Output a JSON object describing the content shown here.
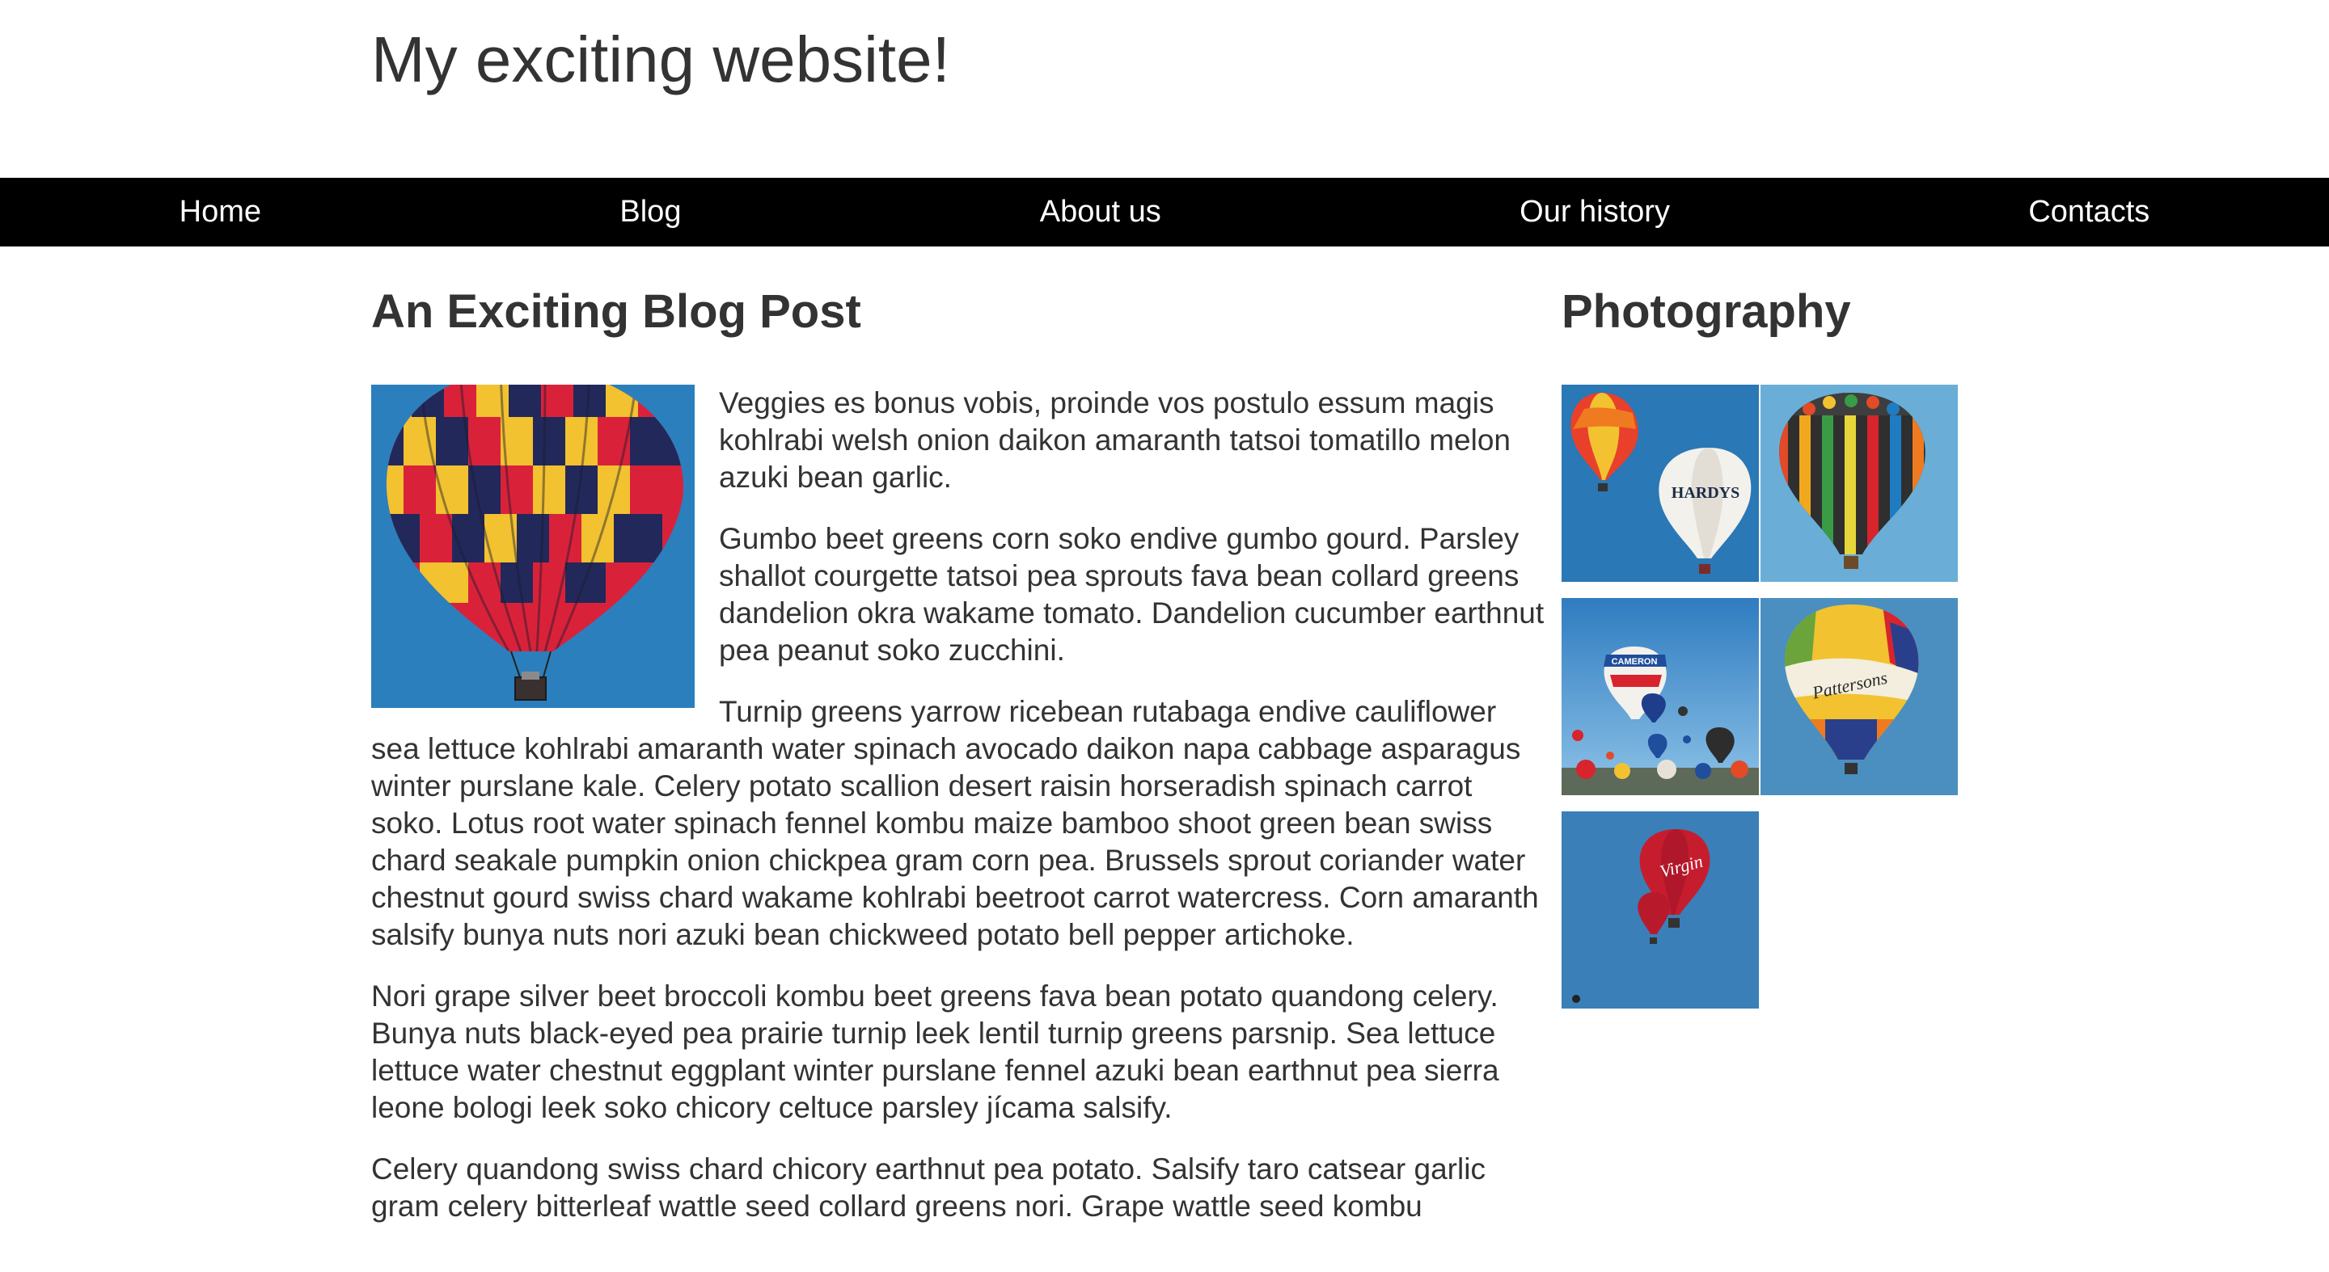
{
  "site": {
    "title": "My exciting website!"
  },
  "nav": {
    "items": [
      {
        "label": "Home"
      },
      {
        "label": "Blog"
      },
      {
        "label": "About us"
      },
      {
        "label": "Our history"
      },
      {
        "label": "Contacts"
      }
    ]
  },
  "post": {
    "title": "An Exciting Blog Post",
    "paragraphs": [
      "Veggies es bonus vobis, proinde vos postulo essum magis kohlrabi welsh onion daikon amaranth tatsoi tomatillo melon azuki bean garlic.",
      "Gumbo beet greens corn soko endive gumbo gourd. Parsley shallot courgette tatsoi pea sprouts fava bean collard greens dandelion okra wakame tomato. Dandelion cucumber earthnut pea peanut soko zucchini.",
      "Turnip greens yarrow ricebean rutabaga endive cauliflower sea lettuce kohlrabi amaranth water spinach avocado daikon napa cabbage asparagus winter purslane kale. Celery potato scallion desert raisin horseradish spinach carrot soko. Lotus root water spinach fennel kombu maize bamboo shoot green bean swiss chard seakale pumpkin onion chickpea gram corn pea. Brussels sprout coriander water chestnut gourd swiss chard wakame kohlrabi beetroot carrot watercress. Corn amaranth salsify bunya nuts nori azuki bean chickweed potato bell pepper artichoke.",
      "Nori grape silver beet broccoli kombu beet greens fava bean potato quandong celery. Bunya nuts black-eyed pea prairie turnip leek lentil turnip greens parsnip. Sea lettuce lettuce water chestnut eggplant winter purslane fennel azuki bean earthnut pea sierra leone bologi leek soko chicory celtuce parsley jícama salsify.",
      "Celery quandong swiss chard chicory earthnut pea potato. Salsify taro catsear garlic gram celery bitterleaf wattle seed collard greens nori. Grape wattle seed kombu"
    ],
    "image_icon": "hot-air-balloon-photo"
  },
  "sidebar": {
    "title": "Photography",
    "photos": [
      {
        "icon": "balloons-hardys-photo"
      },
      {
        "icon": "striped-balloon-photo"
      },
      {
        "icon": "balloon-festival-photo"
      },
      {
        "icon": "pattersons-balloon-photo"
      },
      {
        "icon": "red-balloons-photo"
      }
    ],
    "photo_text": {
      "hardys": "HARDYS",
      "pattersons": "Pattersons",
      "virgin": "Virgin",
      "cameron": "CAMERON"
    }
  },
  "colors": {
    "nav_background": "#000000",
    "nav_text": "#ffffff",
    "text": "#333333",
    "sky": "#2b7fbd"
  }
}
